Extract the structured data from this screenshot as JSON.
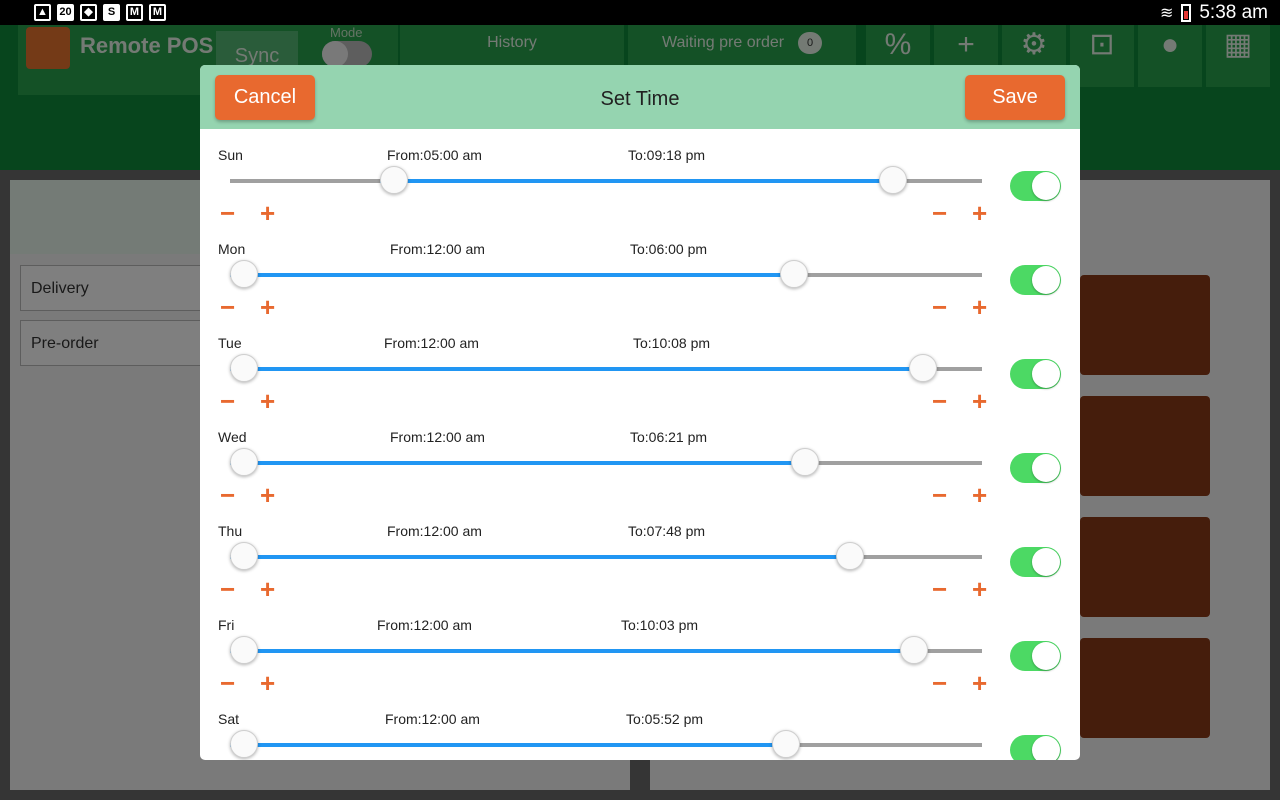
{
  "status_bar": {
    "notification_count": "20",
    "time": "5:38 am"
  },
  "app": {
    "title": "Remote POS",
    "sync_label": "Sync",
    "mode_label": "Mode",
    "history_tab": "History",
    "waiting_tab": "Waiting pre order",
    "waiting_count": "0",
    "side_fields": [
      "Delivery",
      "Pre-order"
    ]
  },
  "dialog": {
    "title": "Set Time",
    "cancel_label": "Cancel",
    "save_label": "Save",
    "minus_glyph": "−",
    "plus_glyph": "+",
    "days": [
      {
        "day": "Sun",
        "from": "From:05:00 am",
        "to": "To:09:18 pm",
        "from_fraction": 0.199,
        "to_fraction": 0.881,
        "enabled": true
      },
      {
        "day": "Mon",
        "from": "From:12:00 am",
        "to": "To:06:00 pm",
        "from_fraction": 0.0,
        "to_fraction": 0.75,
        "enabled": true
      },
      {
        "day": "Tue",
        "from": "From:12:00 am",
        "to": "To:10:08 pm",
        "from_fraction": 0.0,
        "to_fraction": 0.922,
        "enabled": true
      },
      {
        "day": "Wed",
        "from": "From:12:00 am",
        "to": "To:06:21 pm",
        "from_fraction": 0.0,
        "to_fraction": 0.765,
        "enabled": true
      },
      {
        "day": "Thu",
        "from": "From:12:00 am",
        "to": "To:07:48 pm",
        "from_fraction": 0.0,
        "to_fraction": 0.825,
        "enabled": true
      },
      {
        "day": "Fri",
        "from": "From:12:00 am",
        "to": "To:10:03 pm",
        "from_fraction": 0.0,
        "to_fraction": 0.91,
        "enabled": true
      },
      {
        "day": "Sat",
        "from": "From:12:00 am",
        "to": "To:05:52 pm",
        "from_fraction": 0.0,
        "to_fraction": 0.74,
        "enabled": true
      }
    ]
  },
  "colors": {
    "header": "#95d4b0",
    "button": "#e8692f",
    "slider_active": "#2196f3",
    "toggle_on": "#4cd964",
    "app_green": "#0e8a3a"
  }
}
